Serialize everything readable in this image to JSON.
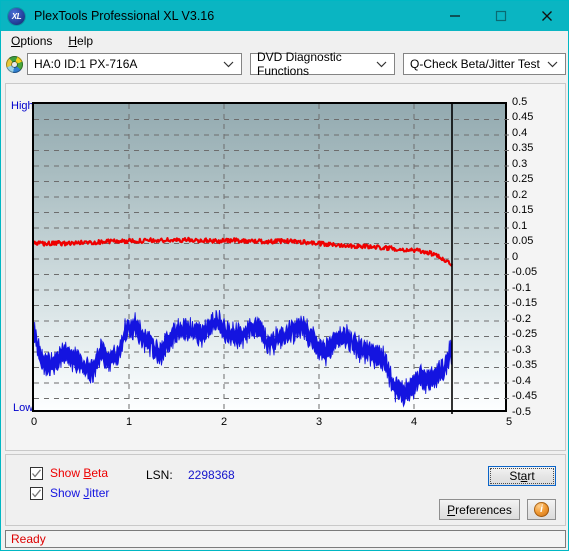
{
  "window": {
    "title": "PlexTools Professional XL V3.16",
    "icon": "XL",
    "minimize_icon": "minimize-icon",
    "maximize_icon": "maximize-icon",
    "close_icon": "close-icon",
    "accent_color": "#0ab5c2"
  },
  "menu": {
    "items": [
      {
        "label": "Options",
        "accel": "O"
      },
      {
        "label": "Help",
        "accel": "H"
      }
    ]
  },
  "toolbar": {
    "disc_icon": "optical-disc-icon",
    "drive_select": {
      "value": "HA:0 ID:1  PX-716A",
      "options": [
        "HA:0 ID:1  PX-716A"
      ]
    },
    "function_select": {
      "value": "DVD Diagnostic Functions",
      "options": [
        "DVD Diagnostic Functions"
      ]
    },
    "test_select": {
      "value": "Q-Check Beta/Jitter Test",
      "options": [
        "Q-Check Beta/Jitter Test"
      ]
    }
  },
  "chart_labels": {
    "high": "High",
    "low": "Low"
  },
  "controls": {
    "show_beta": {
      "label_pre": "Show ",
      "accel": "B",
      "label_post": "eta",
      "checked": true,
      "color": "#ee0000"
    },
    "show_jitter": {
      "label_pre": "Show ",
      "accel": "J",
      "label_post": "itter",
      "checked": true,
      "color": "#1414e0"
    },
    "lsn_label": "LSN:",
    "lsn_value": "2298368",
    "start_button": {
      "pre": "St",
      "accel": "a",
      "post": "rt"
    },
    "preferences_button": {
      "pre": "",
      "accel": "P",
      "post": "references"
    },
    "info_button": {
      "glyph": "i",
      "name": "info-icon"
    }
  },
  "status": {
    "text": "Ready",
    "color": "#dd0000"
  },
  "chart_data": {
    "type": "line",
    "title": "Q-Check Beta/Jitter Test",
    "xlabel": "",
    "ylabel": "",
    "xlim": [
      0,
      5
    ],
    "ylim": [
      -0.5,
      0.5
    ],
    "grid": true,
    "x_ticks": [
      0,
      1,
      2,
      3,
      4,
      5
    ],
    "y_ticks": [
      0.5,
      0.45,
      0.4,
      0.35,
      0.3,
      0.25,
      0.2,
      0.15,
      0.1,
      0.05,
      0,
      -0.05,
      -0.1,
      -0.15,
      -0.2,
      -0.25,
      -0.3,
      -0.35,
      -0.4,
      -0.45,
      -0.5
    ],
    "cursor_x": 4.4,
    "legend_position": "bottom-left",
    "series": [
      {
        "name": "Beta",
        "color": "#ee0000",
        "x": [
          0.0,
          0.09,
          0.18,
          0.26,
          0.35,
          0.44,
          0.53,
          0.62,
          0.7,
          0.79,
          0.88,
          0.97,
          1.06,
          1.14,
          1.23,
          1.32,
          1.41,
          1.5,
          1.58,
          1.67,
          1.76,
          1.85,
          1.94,
          2.02,
          2.11,
          2.2,
          2.29,
          2.38,
          2.46,
          2.55,
          2.64,
          2.73,
          2.82,
          2.9,
          2.99,
          3.08,
          3.17,
          3.26,
          3.34,
          3.43,
          3.52,
          3.61,
          3.7,
          3.78,
          3.87,
          3.96,
          4.05,
          4.14,
          4.22,
          4.31,
          4.4
        ],
        "y": [
          0.049,
          0.05,
          0.049,
          0.051,
          0.05,
          0.052,
          0.053,
          0.054,
          0.055,
          0.057,
          0.058,
          0.057,
          0.059,
          0.058,
          0.06,
          0.059,
          0.061,
          0.06,
          0.062,
          0.061,
          0.06,
          0.059,
          0.058,
          0.059,
          0.06,
          0.059,
          0.058,
          0.057,
          0.056,
          0.057,
          0.058,
          0.057,
          0.055,
          0.053,
          0.05,
          0.047,
          0.046,
          0.045,
          0.043,
          0.041,
          0.04,
          0.038,
          0.036,
          0.034,
          0.031,
          0.029,
          0.026,
          0.022,
          0.013,
          0.0,
          -0.018
        ]
      },
      {
        "name": "Jitter",
        "color": "#1414e0",
        "x": [
          0.0,
          0.09,
          0.18,
          0.26,
          0.35,
          0.44,
          0.53,
          0.62,
          0.7,
          0.79,
          0.88,
          0.97,
          1.06,
          1.14,
          1.23,
          1.32,
          1.41,
          1.5,
          1.58,
          1.67,
          1.76,
          1.85,
          1.94,
          2.02,
          2.11,
          2.2,
          2.29,
          2.38,
          2.46,
          2.55,
          2.64,
          2.73,
          2.82,
          2.9,
          2.99,
          3.08,
          3.17,
          3.26,
          3.34,
          3.43,
          3.52,
          3.61,
          3.7,
          3.78,
          3.87,
          3.96,
          4.05,
          4.14,
          4.22,
          4.31,
          4.4
        ],
        "y": [
          -0.245,
          -0.33,
          -0.345,
          -0.32,
          -0.31,
          -0.33,
          -0.345,
          -0.36,
          -0.3,
          -0.33,
          -0.31,
          -0.225,
          -0.215,
          -0.255,
          -0.27,
          -0.31,
          -0.265,
          -0.235,
          -0.225,
          -0.23,
          -0.25,
          -0.215,
          -0.2,
          -0.235,
          -0.245,
          -0.255,
          -0.215,
          -0.23,
          -0.275,
          -0.26,
          -0.245,
          -0.23,
          -0.215,
          -0.25,
          -0.29,
          -0.3,
          -0.26,
          -0.25,
          -0.265,
          -0.29,
          -0.3,
          -0.31,
          -0.33,
          -0.415,
          -0.43,
          -0.425,
          -0.38,
          -0.39,
          -0.385,
          -0.36,
          -0.29
        ],
        "band": 0.035
      }
    ]
  }
}
